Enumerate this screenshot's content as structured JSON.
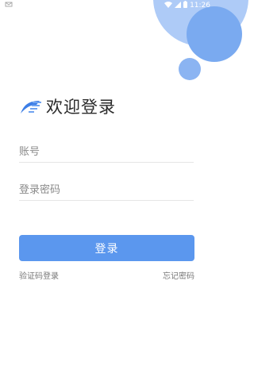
{
  "status_bar": {
    "time": "11:26",
    "icons": [
      "notification-icon",
      "wifi-icon",
      "cell-signal-icon",
      "battery-icon"
    ]
  },
  "colors": {
    "accent": "#5b97ee",
    "circle_light": "#aecbf7",
    "circle_mid": "#7aaaf0"
  },
  "header": {
    "logo": "app-logo-icon",
    "title": "欢迎登录"
  },
  "form": {
    "account_placeholder": "账号",
    "password_placeholder": "登录密码",
    "login_label": "登录"
  },
  "links": {
    "sms_login": "验证码登录",
    "forgot_password": "忘记密码"
  }
}
